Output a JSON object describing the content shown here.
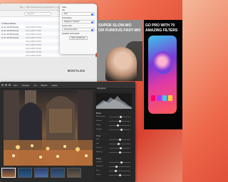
{
  "finder": {
    "path": "Ben > Mac Windows og programmer > brusser",
    "search_placeholder": "Søgefelt",
    "rows": [
      {
        "name": "",
        "date": "",
        "size": ""
      },
      {
        "name": "ni Skærmbillede",
        "date": "",
        "size": ""
      },
      {
        "name": "ei om 19.40.04.png",
        "date": "13-11-2021 19:40",
        "size": ""
      },
      {
        "name": "ei om 19.40.04.png",
        "date": "13-11-2021 19:40",
        "size": ""
      },
      {
        "name": "ei om 19.40.04.png",
        "date": "13-11-2021 19:40",
        "size": ""
      },
      {
        "name": "ei om 19.40.04.png",
        "date": "13-11-2021 19:40",
        "size": ""
      },
      {
        "name": "",
        "date": "13-11-2021 19:40",
        "size": ""
      },
      {
        "name": "",
        "date": "13-11-2021 19:40",
        "size": ""
      },
      {
        "name": "",
        "date": "13-11-2021 19:40",
        "size": ""
      },
      {
        "name": "",
        "date": "13-11-2021 19:40",
        "size": ""
      },
      {
        "name": "",
        "date": "13-11-2021 19:40",
        "size": ""
      },
      {
        "name": "",
        "date": "13-11-2021 19:40",
        "size": ""
      },
      {
        "name": "",
        "date": "",
        "size": ""
      }
    ]
  },
  "popover": {
    "title": "Filtre",
    "label1": "Vis",
    "select1": "100",
    "label2": "Fotoplader:",
    "select2": "Mappens indhold",
    "label3": "Sorter efter:",
    "select3": "Senest ændret",
    "label4": "Opdater automatisk",
    "button": "Skift indstillinger"
  },
  "preview": {
    "caption": "BOOTLOG"
  },
  "ad1": {
    "line1": "SUPER SLOW-MO",
    "line2": "OR FURIOUS FAST-MO"
  },
  "ad2": {
    "line1": "GO PRO WITH 70",
    "line2": "AMAZING FILTERS"
  },
  "editor": {
    "menu": [
      "Filer",
      "Rediger",
      "Vis",
      "Billede",
      "Hjælp"
    ],
    "side_header": "Histogram",
    "side_sections": [
      "Basis",
      "Tone",
      "Farve"
    ],
    "sliders": [
      {
        "label": "Eksponering",
        "value": 0.55
      },
      {
        "label": "Kontrast",
        "value": 0.5
      },
      {
        "label": "Højlys",
        "value": 0.4
      },
      {
        "label": "Skygger",
        "value": 0.6
      },
      {
        "label": "Hvid",
        "value": 0.5
      },
      {
        "label": "Sort",
        "value": 0.45
      },
      {
        "label": "Klarhed",
        "value": 0.55
      },
      {
        "label": "Mætning",
        "value": 0.5
      },
      {
        "label": "Levende",
        "value": 0.6
      },
      {
        "label": "Skarphed",
        "value": 0.35
      },
      {
        "label": "Støj",
        "value": 0.3
      },
      {
        "label": "Vignet",
        "value": 0.5
      }
    ]
  },
  "colors": {
    "accent": "#3b82f6",
    "desktop": "#e35a3d"
  }
}
